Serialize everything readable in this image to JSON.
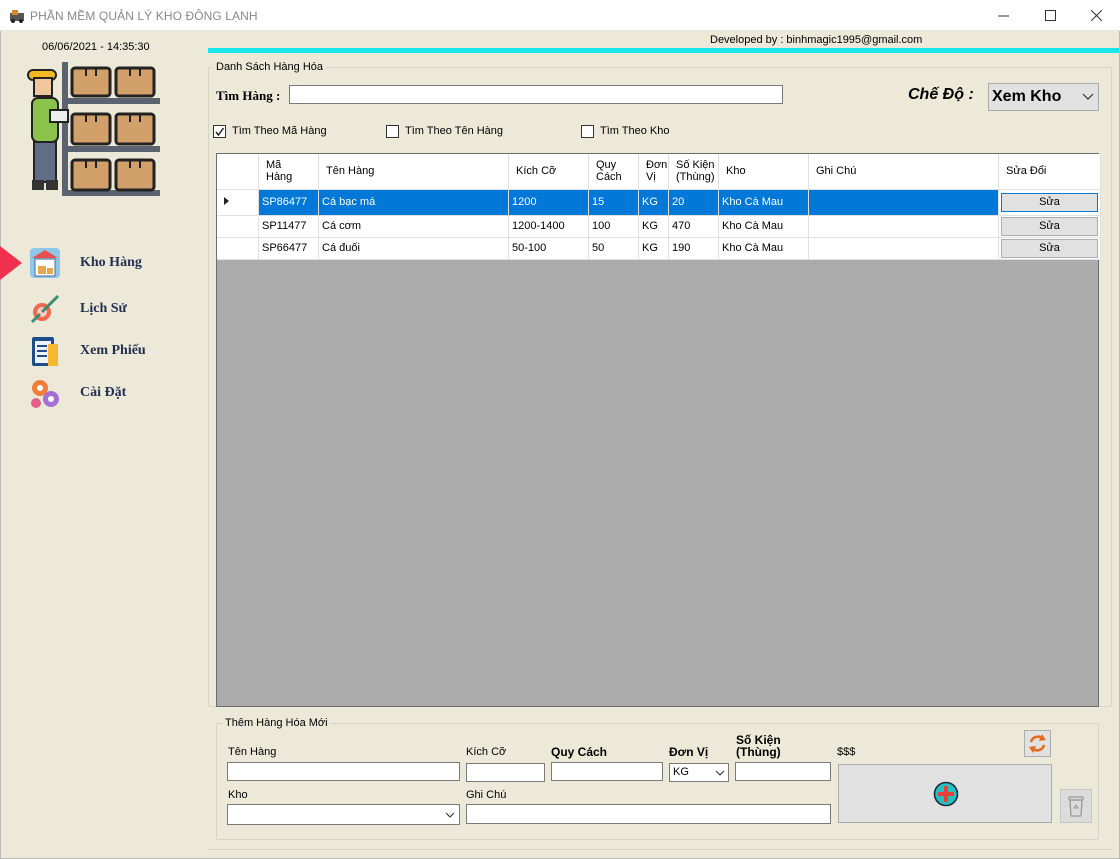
{
  "window": {
    "title": "PHẦN MỀM QUẢN LÝ KHO ĐÔNG LẠNH",
    "minimize": "—",
    "maximize": "☐",
    "close": "✕"
  },
  "sidebar": {
    "datetime": "06/06/2021 - 14:35:30",
    "items": [
      {
        "label": "Kho Hàng",
        "icon": "warehouse-icon",
        "active": true
      },
      {
        "label": "Lịch Sử",
        "icon": "history-icon",
        "active": false
      },
      {
        "label": "Xem Phiếu",
        "icon": "clipboard-icon",
        "active": false
      },
      {
        "label": "Cài Đặt",
        "icon": "gears-icon",
        "active": false
      }
    ]
  },
  "header": {
    "developer": "Developed by : binhmagic1995@gmail.com"
  },
  "list": {
    "group_title": "Danh Sách Hàng Hóa",
    "search_label": "Tìm Hàng :",
    "search_value": "",
    "mode_label": "Chế Độ :",
    "mode_value": "Xem Kho",
    "filters": [
      {
        "label": "Tìm Theo Mã Hàng",
        "checked": true
      },
      {
        "label": "Tìm Theo Tên Hàng",
        "checked": false
      },
      {
        "label": "Tìm Theo Kho",
        "checked": false
      }
    ],
    "columns": [
      "Mã Hàng",
      "Tên Hàng",
      "Kích Cỡ",
      "Quy Cách",
      "Đơn Vị",
      "Số Kiện (Thùng)",
      "Kho",
      "Ghi Chú",
      "Sửa Đổi"
    ],
    "column_lines": [
      [
        "Mã",
        "Hàng"
      ],
      [
        "Tên Hàng"
      ],
      [
        "Kích Cỡ"
      ],
      [
        "Quy",
        "Cách"
      ],
      [
        "Đơn",
        "Vị"
      ],
      [
        "Số Kiện",
        "(Thùng)"
      ],
      [
        "Kho"
      ],
      [
        "Ghi Chú"
      ],
      [
        "Sửa Đổi"
      ]
    ],
    "rows": [
      {
        "ma": "SP86477",
        "ten": "Cá bạc má",
        "kichco": "1200",
        "quycach": "15",
        "donvi": "KG",
        "sokien": "20",
        "kho": "Kho Cà Mau",
        "ghichu": "",
        "action": "Sửa"
      },
      {
        "ma": "SP11477",
        "ten": "Cá cơm",
        "kichco": "1200-1400",
        "quycach": "100",
        "donvi": "KG",
        "sokien": "470",
        "kho": "Kho Cà Mau",
        "ghichu": "",
        "action": "Sửa"
      },
      {
        "ma": "SP66477",
        "ten": "Cá đuối",
        "kichco": "50-100",
        "quycach": "50",
        "donvi": "KG",
        "sokien": "190",
        "kho": "Kho Cà Mau",
        "ghichu": "",
        "action": "Sửa"
      }
    ],
    "selected_row": 0
  },
  "add_form": {
    "group_title": "Thêm Hàng Hóa Mới",
    "ten_hang_label": "Tên Hàng",
    "kich_co_label": "Kích Cỡ",
    "quy_cach_label": "Quy Cách",
    "don_vi_label": "Đơn Vị",
    "so_kien_label_1": "Số Kiện",
    "so_kien_label_2": "(Thùng)",
    "price_label": "$$$",
    "kho_label": "Kho",
    "ghi_chu_label": "Ghi Chú",
    "don_vi_value": "KG",
    "ten_hang_value": "",
    "kich_co_value": "",
    "quy_cach_value": "",
    "so_kien_value": "",
    "kho_value": "",
    "ghi_chu_value": ""
  },
  "colors": {
    "accent_bar": "#19E6E8",
    "selection": "#0078D7",
    "nav_marker": "#F0314E",
    "panel_bg": "#ECE9D8"
  }
}
